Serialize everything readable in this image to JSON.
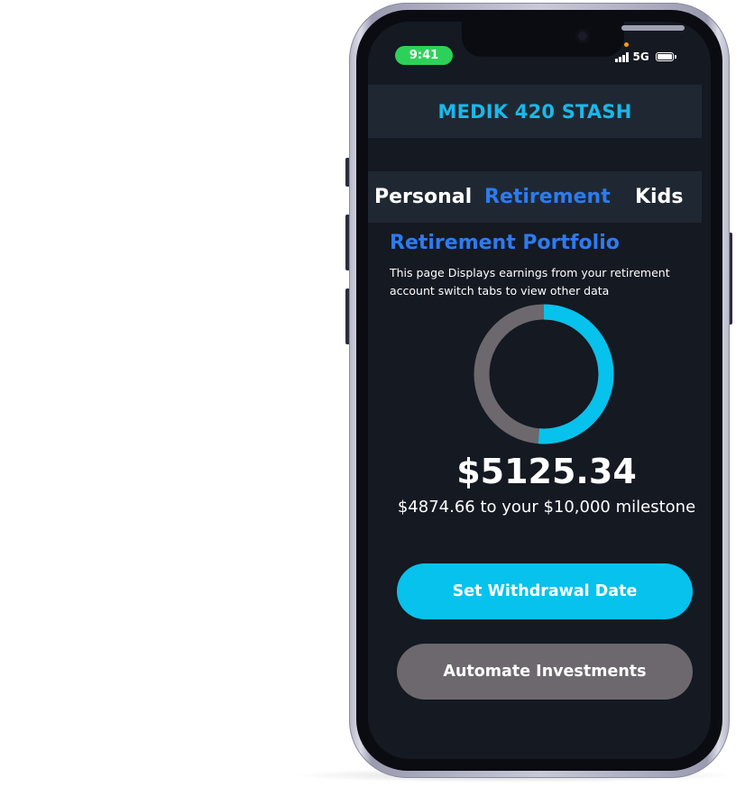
{
  "status_bar": {
    "time": "9:41",
    "network": "5G"
  },
  "app": {
    "title": "MEDIK 420 STASH"
  },
  "tabs": [
    {
      "label": "Personal",
      "active": false
    },
    {
      "label": "Retirement",
      "active": true
    },
    {
      "label": "Kids",
      "active": false
    }
  ],
  "portfolio": {
    "title": "Retirement Portfolio",
    "description": "This page Displays earnings from your retirement account switch tabs to view other data",
    "amount": "$5125.34",
    "milestone_text": "$4874.66 to your $10,000 milestone",
    "progress_fraction": 0.5125
  },
  "buttons": {
    "withdrawal": "Set Withdrawal Date",
    "automate": "Automate Investments"
  },
  "colors": {
    "accent_cyan": "#06c2ec",
    "accent_blue": "#2d7bef",
    "title_cyan": "#1ab8ea",
    "track_gray": "#6d686e",
    "background": "#141922",
    "panel": "#1f2832",
    "status_green": "#2ed158"
  }
}
